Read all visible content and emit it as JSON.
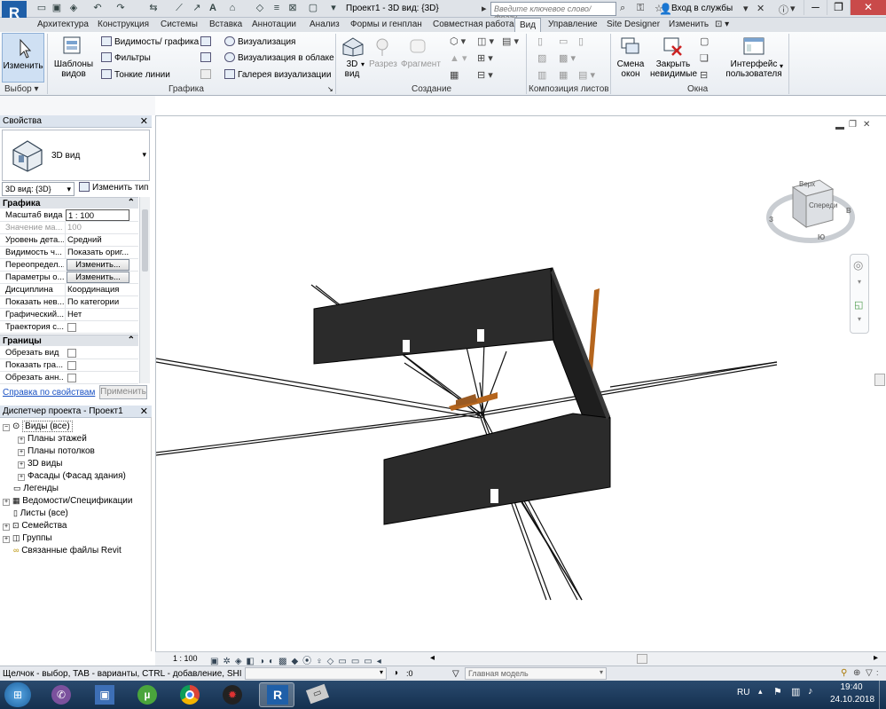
{
  "titlebar": {
    "title": "Проект1 - 3D вид: {3D}",
    "search_placeholder": "Введите ключевое слово/фразу",
    "login": "Вход в службы",
    "logo": "R"
  },
  "tabs": [
    "Архитектура",
    "Конструкция",
    "Системы",
    "Вставка",
    "Аннотации",
    "Анализ",
    "Формы и генплан",
    "Совместная работа",
    "Вид",
    "Управление",
    "Site Designer",
    "Изменить"
  ],
  "ribbon": {
    "select": {
      "modify": "Изменить",
      "panel": "Выбор"
    },
    "graphics": {
      "templates": "Шаблоны видов",
      "visibility": "Видимость/ графика",
      "filters": "Фильтры",
      "thin_lines": "Тонкие линии",
      "panel": "Графика"
    },
    "render": {
      "visualization": "Визуализация",
      "cloud": "Визуализация  в облаке",
      "gallery": "Галерея  визуализации"
    },
    "create": {
      "view3d": "3D вид",
      "section": "Разрез",
      "callout": "Фрагмент",
      "panel": "Создание"
    },
    "sheet": {
      "panel": "Композиция листов"
    },
    "windows": {
      "switch": "Смена окон",
      "close_hidden": "Закрыть невидимые",
      "ui": "Интерфейс пользователя",
      "panel": "Окна"
    }
  },
  "properties": {
    "header": "Свойства",
    "type_name": "3D вид",
    "view_selector": "3D вид: {3D}",
    "edit_type": "Изменить тип",
    "sections": [
      {
        "title": "Графика",
        "rows": [
          {
            "name": "Масштаб вида",
            "value": "1 : 100",
            "kind": "input"
          },
          {
            "name": "Значение ма...",
            "value": "100",
            "kind": "grey"
          },
          {
            "name": "Уровень дета...",
            "value": "Средний",
            "kind": "text"
          },
          {
            "name": "Видимость ч...",
            "value": "Показать ориг...",
            "kind": "text"
          },
          {
            "name": "Переопредел...",
            "value": "Изменить...",
            "kind": "button"
          },
          {
            "name": "Параметры о...",
            "value": "Изменить...",
            "kind": "button"
          },
          {
            "name": "Дисциплина",
            "value": "Координация",
            "kind": "text"
          },
          {
            "name": "Показать нев...",
            "value": "По категории",
            "kind": "text"
          },
          {
            "name": "Графический...",
            "value": "Нет",
            "kind": "text"
          },
          {
            "name": "Траектория с...",
            "value": "",
            "kind": "check"
          }
        ]
      },
      {
        "title": "Границы",
        "rows": [
          {
            "name": "Обрезать вид",
            "value": "",
            "kind": "check"
          },
          {
            "name": "Показать гра...",
            "value": "",
            "kind": "check"
          },
          {
            "name": "Обрезать анн...",
            "value": "",
            "kind": "check"
          }
        ]
      }
    ],
    "help_link": "Справка по свойствам",
    "apply": "Применить"
  },
  "browser": {
    "header": "Диспетчер проекта - Проект1",
    "items": [
      {
        "label": "Виды (все)",
        "level": 0,
        "expand": "-"
      },
      {
        "label": "Планы этажей",
        "level": 1,
        "expand": "+"
      },
      {
        "label": "Планы потолков",
        "level": 1,
        "expand": "+"
      },
      {
        "label": "3D виды",
        "level": 1,
        "expand": "+"
      },
      {
        "label": "Фасады (Фасад здания)",
        "level": 1,
        "expand": "+"
      },
      {
        "label": "Легенды",
        "level": 0,
        "expand": ""
      },
      {
        "label": "Ведомости/Спецификации",
        "level": 0,
        "expand": "+"
      },
      {
        "label": "Листы (все)",
        "level": 0,
        "expand": ""
      },
      {
        "label": "Семейства",
        "level": 0,
        "expand": "+"
      },
      {
        "label": "Группы",
        "level": 0,
        "expand": "+"
      },
      {
        "label": "Связанные файлы Revit",
        "level": 0,
        "expand": ""
      }
    ]
  },
  "viewcube": {
    "top": "Верх",
    "front": "Спереди",
    "compass_s": "Ю",
    "compass_w": "З",
    "compass_e": "В"
  },
  "viewbar": {
    "scale": "1 : 100"
  },
  "status": {
    "hint": "Щелчок - выбор, TAB - варианты, CTRL - добавление, SHIF",
    "count": ":0",
    "model": "Главная модель"
  },
  "taskbar": {
    "lang": "RU",
    "time": "19:40",
    "date": "24.10.2018"
  },
  "colors": {
    "accent": "#1f5fa8",
    "wall": "#2b2b2b",
    "beam": "#b5651d"
  }
}
